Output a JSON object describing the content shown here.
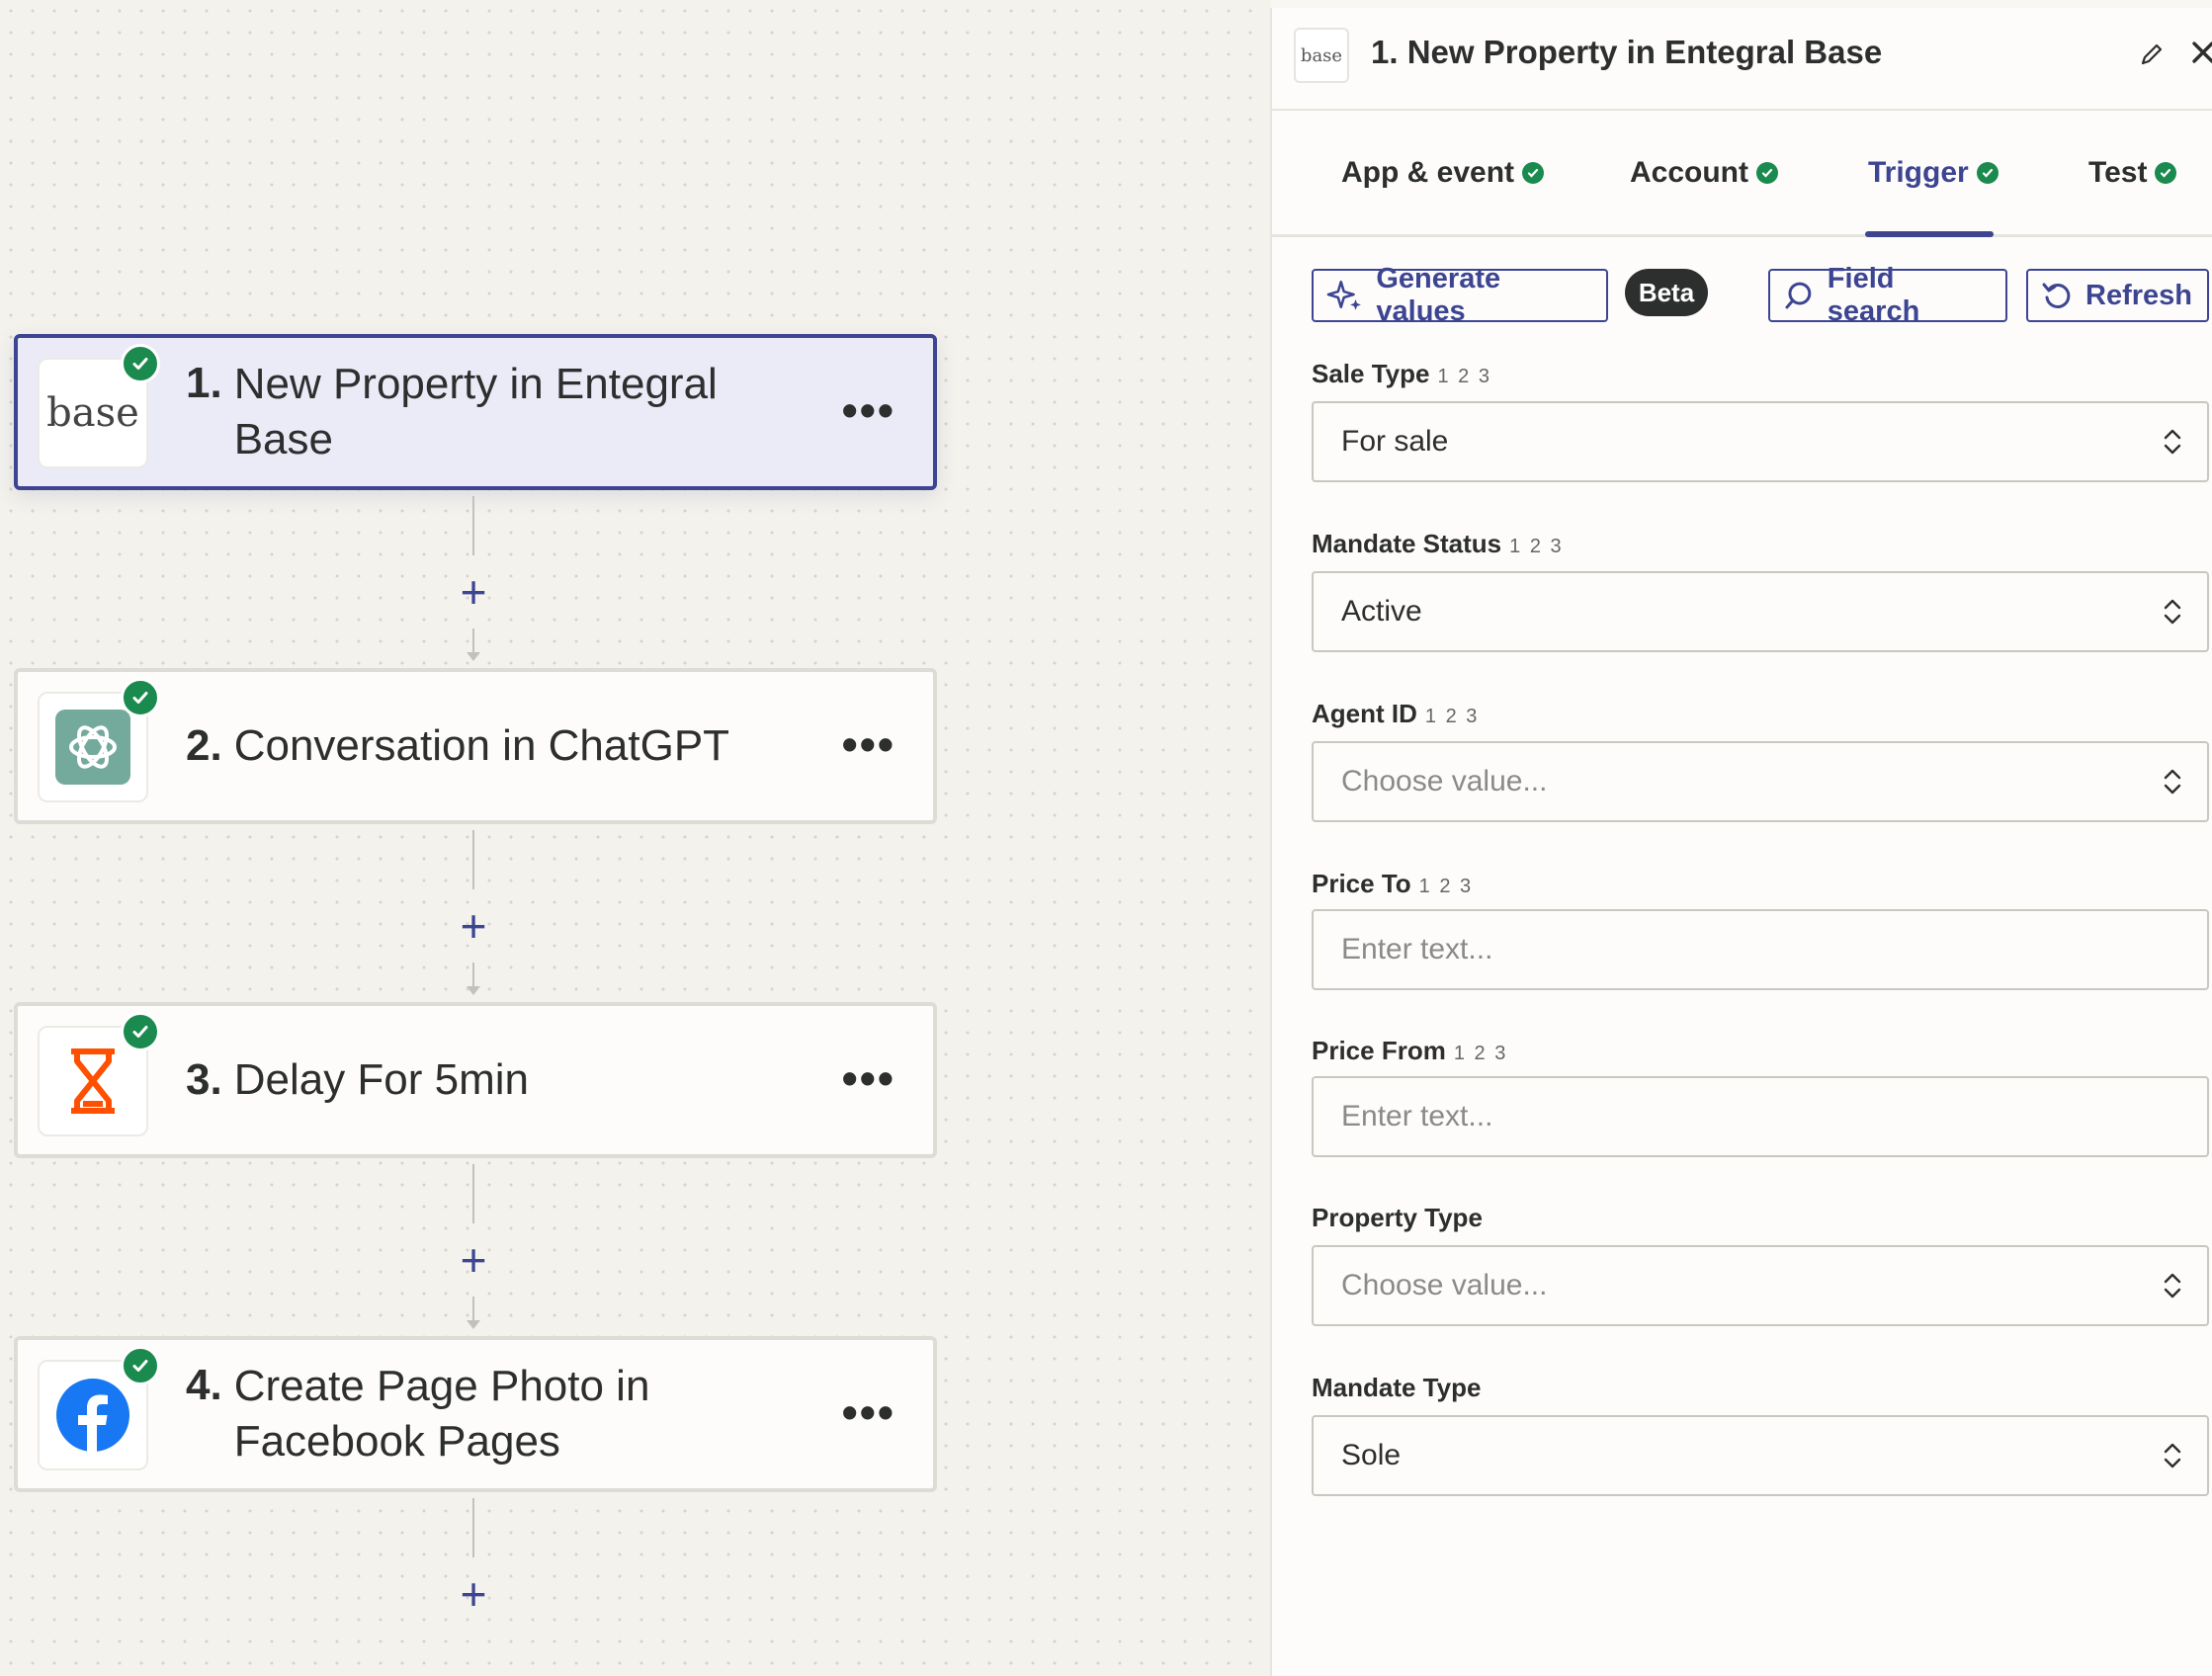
{
  "canvas": {
    "steps": [
      {
        "number": "1.",
        "title": "New Property in Entegral Base",
        "logo": "base",
        "icon": "base-logo-icon"
      },
      {
        "number": "2.",
        "title": "Conversation in ChatGPT",
        "icon": "chatgpt-logo-icon"
      },
      {
        "number": "3.",
        "title": "Delay For 5min",
        "icon": "hourglass-icon"
      },
      {
        "number": "4.",
        "title": "Create Page Photo in Facebook Pages",
        "icon": "facebook-logo-icon"
      }
    ],
    "menu_label": "•••",
    "add_label": "+"
  },
  "panel": {
    "logo": "base",
    "title": "1. New Property in Entegral Base",
    "tabs": [
      {
        "label": "App & event"
      },
      {
        "label": "Account"
      },
      {
        "label": "Trigger"
      },
      {
        "label": "Test"
      }
    ],
    "toolbar": {
      "generate_label": "Generate values",
      "beta_label": "Beta",
      "field_search_label": "Field search",
      "refresh_label": "Refresh"
    },
    "fields": [
      {
        "label": "Sale Type",
        "hint": "1 2 3",
        "type": "select",
        "value": "For sale"
      },
      {
        "label": "Mandate Status",
        "hint": "1 2 3",
        "type": "select",
        "value": "Active"
      },
      {
        "label": "Agent ID",
        "hint": "1 2 3",
        "type": "select",
        "placeholder": "Choose value..."
      },
      {
        "label": "Price To",
        "hint": "1 2 3",
        "type": "text",
        "placeholder": "Enter text..."
      },
      {
        "label": "Price From",
        "hint": "1 2 3",
        "type": "text",
        "placeholder": "Enter text..."
      },
      {
        "label": "Property Type",
        "type": "select",
        "placeholder": "Choose value..."
      },
      {
        "label": "Mandate Type",
        "type": "select",
        "value": "Sole"
      }
    ]
  },
  "colors": {
    "accent": "#3d4592",
    "success": "#1b8a4f",
    "chatgpt": "#74aa9c",
    "delay": "#ff4f00",
    "facebook": "#1877f2"
  }
}
